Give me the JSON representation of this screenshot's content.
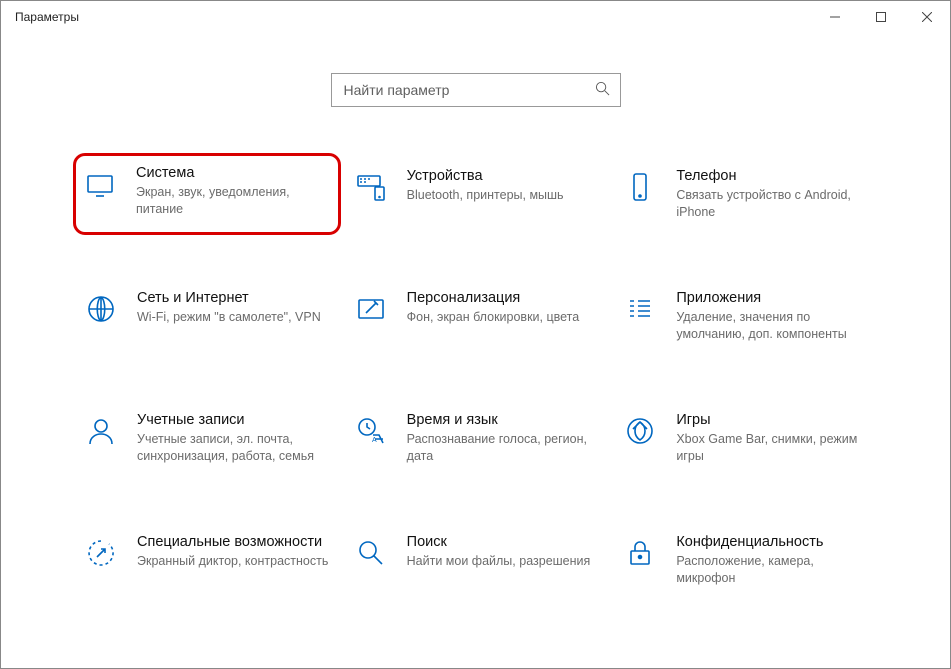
{
  "window": {
    "title": "Параметры"
  },
  "search": {
    "placeholder": "Найти параметр"
  },
  "tiles": [
    {
      "title": "Система",
      "desc": "Экран, звук, уведомления, питание"
    },
    {
      "title": "Устройства",
      "desc": "Bluetooth, принтеры, мышь"
    },
    {
      "title": "Телефон",
      "desc": "Связать устройство с Android, iPhone"
    },
    {
      "title": "Сеть и Интернет",
      "desc": "Wi-Fi, режим \"в самолете\", VPN"
    },
    {
      "title": "Персонализация",
      "desc": "Фон, экран блокировки, цвета"
    },
    {
      "title": "Приложения",
      "desc": "Удаление, значения по умолчанию, доп. компоненты"
    },
    {
      "title": "Учетные записи",
      "desc": "Учетные записи, эл. почта, синхронизация, работа, семья"
    },
    {
      "title": "Время и язык",
      "desc": "Распознавание голоса, регион, дата"
    },
    {
      "title": "Игры",
      "desc": "Xbox Game Bar, снимки, режим игры"
    },
    {
      "title": "Специальные возможности",
      "desc": "Экранный диктор, контрастность"
    },
    {
      "title": "Поиск",
      "desc": "Найти мои файлы, разрешения"
    },
    {
      "title": "Конфиденциальность",
      "desc": "Расположение, камера, микрофон"
    }
  ]
}
